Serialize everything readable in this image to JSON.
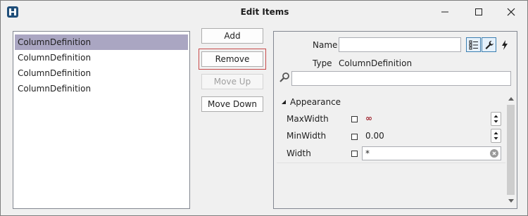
{
  "window": {
    "title": "Edit Items"
  },
  "list": {
    "items": [
      "ColumnDefinition",
      "ColumnDefinition",
      "ColumnDefinition",
      "ColumnDefinition"
    ],
    "selected_index": 0
  },
  "buttons": {
    "add": "Add",
    "remove": "Remove",
    "move_up": "Move Up",
    "move_down": "Move Down"
  },
  "property_grid": {
    "name_label": "Name",
    "name_value": "",
    "type_label": "Type",
    "type_value": "ColumnDefinition",
    "search_value": "",
    "category": "Appearance",
    "properties": [
      {
        "label": "MaxWidth",
        "value": "∞"
      },
      {
        "label": "MinWidth",
        "value": "0.00"
      },
      {
        "label": "Width",
        "value": "*"
      }
    ]
  },
  "colors": {
    "selection": "#aaa6c2",
    "focus_border": "#c84b4b",
    "infinity": "#a0252f"
  },
  "icons": [
    "app-icon",
    "minimize-icon",
    "maximize-icon",
    "close-icon",
    "categorized-icon",
    "wrench-icon",
    "lightning-icon",
    "search-icon",
    "expand-triangle-icon",
    "clear-icon"
  ]
}
